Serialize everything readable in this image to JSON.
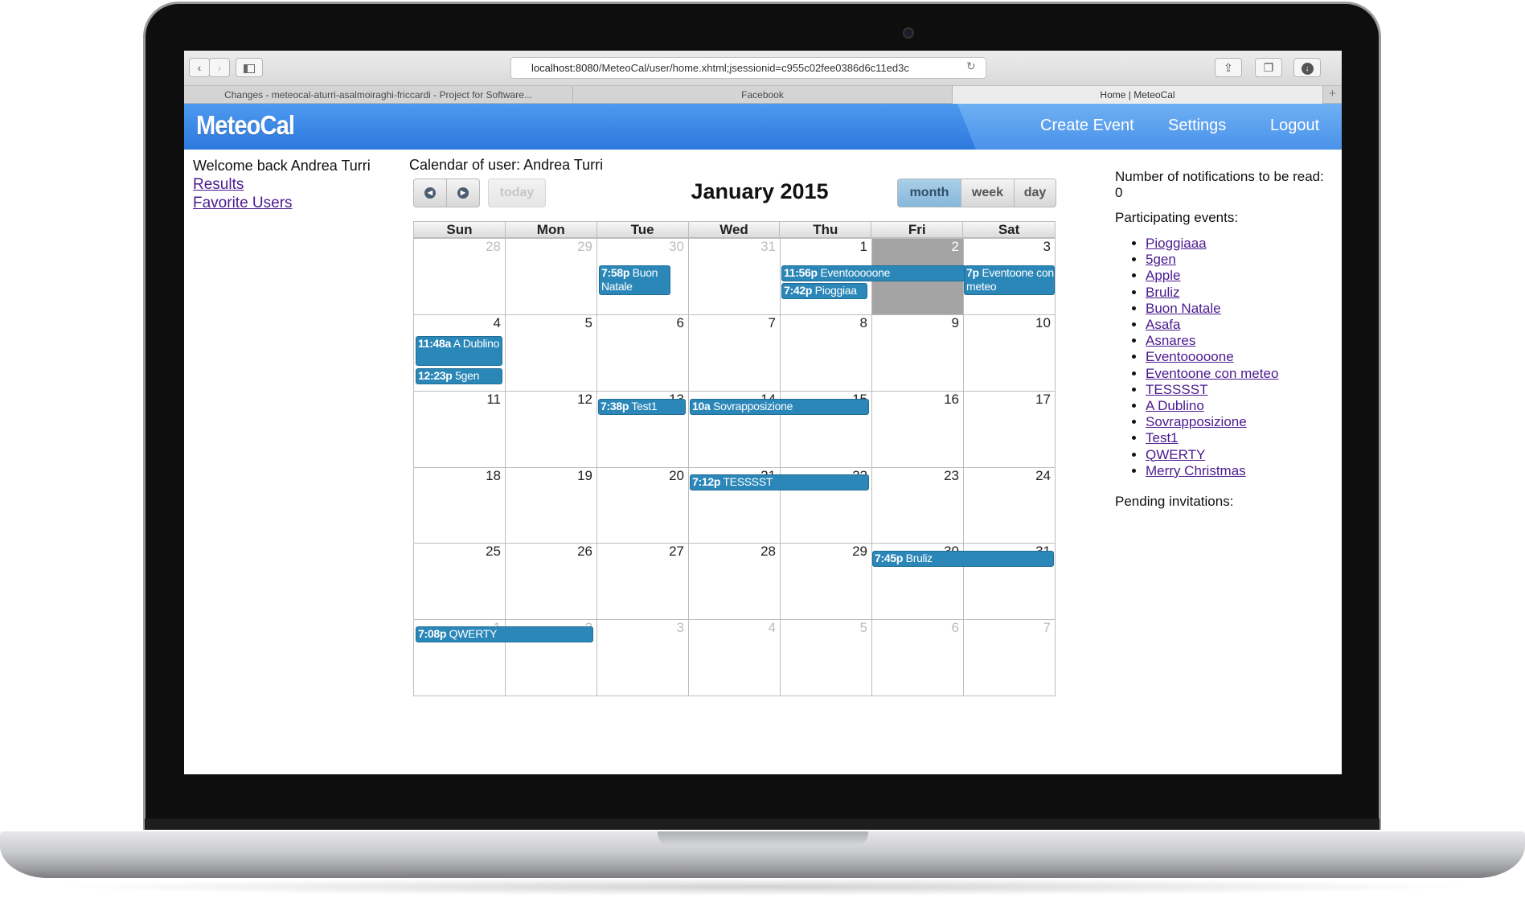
{
  "browser": {
    "url_host": "localhost:8080",
    "url_path": "/MeteoCal/user/home.xhtml;jsessionid=c955c02fee0386d6c11ed3c",
    "tabs": [
      {
        "title": "Changes - meteocal-aturri-asalmoiraghi-friccardi - Project for Software..."
      },
      {
        "title": "Facebook"
      },
      {
        "title": "Home | MeteoCal"
      }
    ]
  },
  "app": {
    "logo": "MeteoCal",
    "nav": {
      "create_event": "Create Event",
      "settings": "Settings",
      "logout": "Logout"
    }
  },
  "left": {
    "welcome": "Welcome back Andrea Turri",
    "results": "Results",
    "favorite_users": "Favorite Users"
  },
  "calendar": {
    "owner": "Calendar of user: Andrea Turri",
    "title": "January 2015",
    "today_label": "today",
    "views": {
      "month": "month",
      "week": "week",
      "day": "day"
    },
    "weekdays": [
      "Sun",
      "Mon",
      "Tue",
      "Wed",
      "Thu",
      "Fri",
      "Sat"
    ],
    "days": [
      "28",
      "29",
      "30",
      "31",
      "1",
      "2",
      "3",
      "4",
      "5",
      "6",
      "7",
      "8",
      "9",
      "10",
      "11",
      "12",
      "13",
      "14",
      "15",
      "16",
      "17",
      "18",
      "19",
      "20",
      "21",
      "22",
      "23",
      "24",
      "25",
      "26",
      "27",
      "28",
      "29",
      "30",
      "31",
      "1",
      "2",
      "3",
      "4",
      "5",
      "6",
      "7"
    ],
    "events": [
      {
        "time": "7:58p",
        "title": "Buon Natale"
      },
      {
        "time": "11:56p",
        "title": "Eventooooone"
      },
      {
        "time": "7:42p",
        "title": "Pioggiaa"
      },
      {
        "time": "7p",
        "title": "Eventoone con meteo"
      },
      {
        "time": "11:48a",
        "title": "A Dublino"
      },
      {
        "time": "12:23p",
        "title": "5gen"
      },
      {
        "time": "7:38p",
        "title": "Test1"
      },
      {
        "time": "10a",
        "title": "Sovrapposizione"
      },
      {
        "time": "7:12p",
        "title": "TESSSST"
      },
      {
        "time": "7:45p",
        "title": "Bruliz"
      },
      {
        "time": "7:08p",
        "title": "QWERTY"
      }
    ]
  },
  "right": {
    "notifications": "Number of notifications to be read: 0",
    "participating_heading": "Participating events:",
    "participating": [
      "Pioggiaaa",
      "5gen",
      "Apple",
      "Bruliz",
      "Buon Natale",
      "Asafa",
      "Asnares",
      "Eventooooone",
      "Eventoone con meteo",
      "TESSSST",
      "A Dublino",
      "Sovrapposizione",
      "Test1",
      "QWERTY",
      "Merry Christmas"
    ],
    "pending_heading": "Pending invitations:"
  }
}
